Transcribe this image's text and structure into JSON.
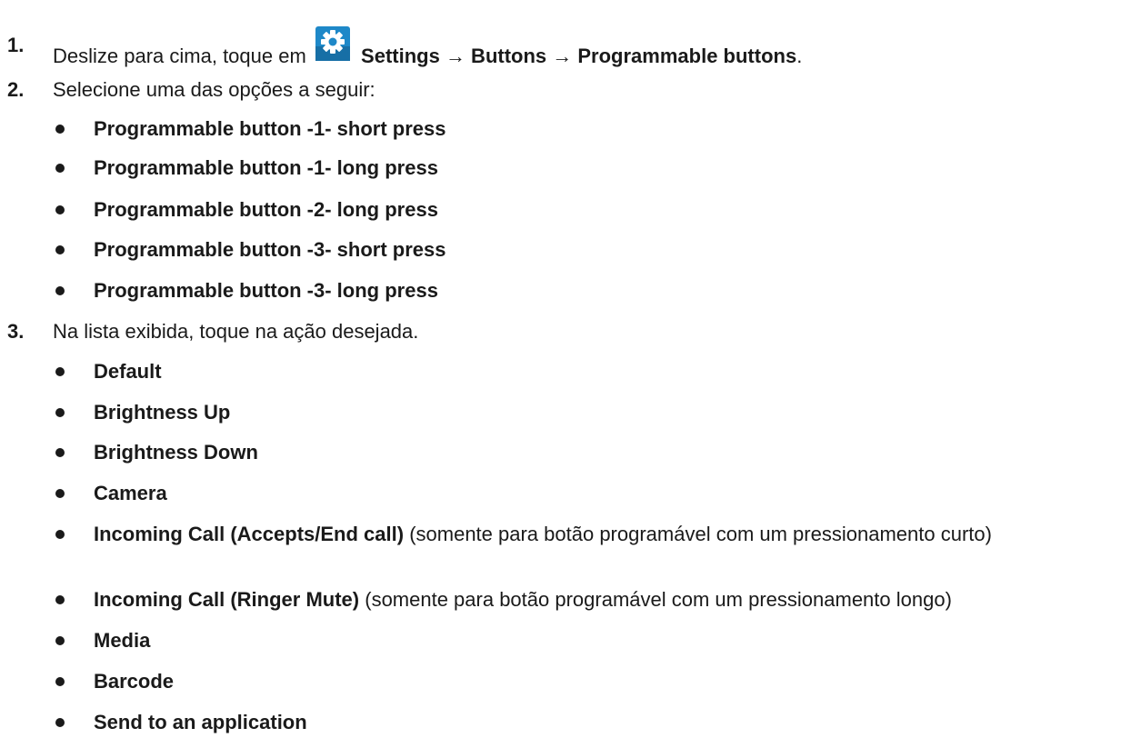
{
  "steps": [
    {
      "num": "1.",
      "text_before": "Deslize para cima, toque em",
      "icon": "settings-gear-icon",
      "path_bold": "Settings → Buttons → Programmable buttons",
      "text_after": "."
    },
    {
      "num": "2.",
      "text": "Selecione uma das opções a seguir:",
      "options": [
        "Programmable button -1- short press",
        "Programmable button -1- long press",
        "Programmable button -2- long press",
        "Programmable button -3- short press",
        "Programmable button -3- long press"
      ]
    },
    {
      "num": "3.",
      "text": "Na lista exibida, toque na ação desejada.",
      "actions": [
        {
          "bold": "Default",
          "note": ""
        },
        {
          "bold": "Brightness Up",
          "note": ""
        },
        {
          "bold": "Brightness Down",
          "note": ""
        },
        {
          "bold": "Camera",
          "note": ""
        },
        {
          "bold": "Incoming Call (Accepts/End call)",
          "note": " (somente para botão programável com um pressionamento curto)"
        },
        {
          "bold": "Incoming Call (Ringer Mute)",
          "note": " (somente para botão programável com um pressionamento longo)"
        },
        {
          "bold": "Media",
          "note": ""
        },
        {
          "bold": "Barcode",
          "note": ""
        },
        {
          "bold": "Send to an application",
          "note": ""
        }
      ]
    }
  ],
  "colors": {
    "text": "#1a1a1a",
    "icon_bg": "#1e88c8"
  }
}
